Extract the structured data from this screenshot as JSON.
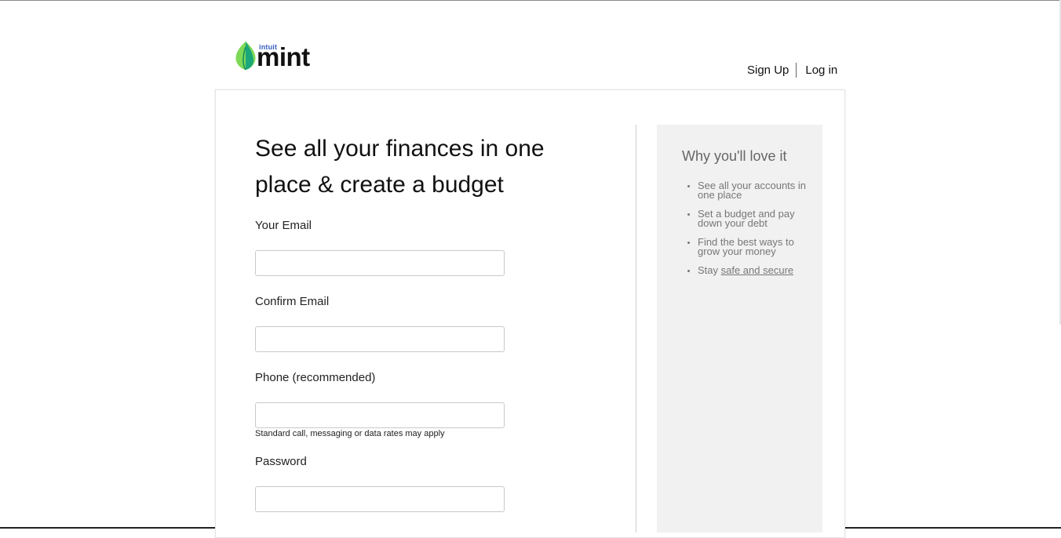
{
  "header": {
    "logo_brand": "intuit",
    "logo_name": "mint",
    "nav": {
      "signup": "Sign Up",
      "login": "Log in"
    }
  },
  "form": {
    "headline": "See all your finances in one place & create a budget",
    "email": {
      "label": "Your Email",
      "value": ""
    },
    "confirm_email": {
      "label": "Confirm Email",
      "value": ""
    },
    "phone": {
      "label": "Phone (recommended)",
      "value": "",
      "note": "Standard call, messaging or data rates may apply"
    },
    "password": {
      "label": "Password",
      "value": ""
    }
  },
  "side": {
    "title": "Why you'll love it",
    "items": [
      "See all your accounts in one place",
      "Set a budget and pay down your debt",
      "Find the best ways to grow your money"
    ],
    "last_item_prefix": "Stay ",
    "last_item_link": "safe and secure"
  },
  "colors": {
    "leaf_light": "#7ed957",
    "leaf_dark": "#1aa77a",
    "intuit_blue": "#365ebf",
    "side_bg": "#f1f1f1"
  }
}
